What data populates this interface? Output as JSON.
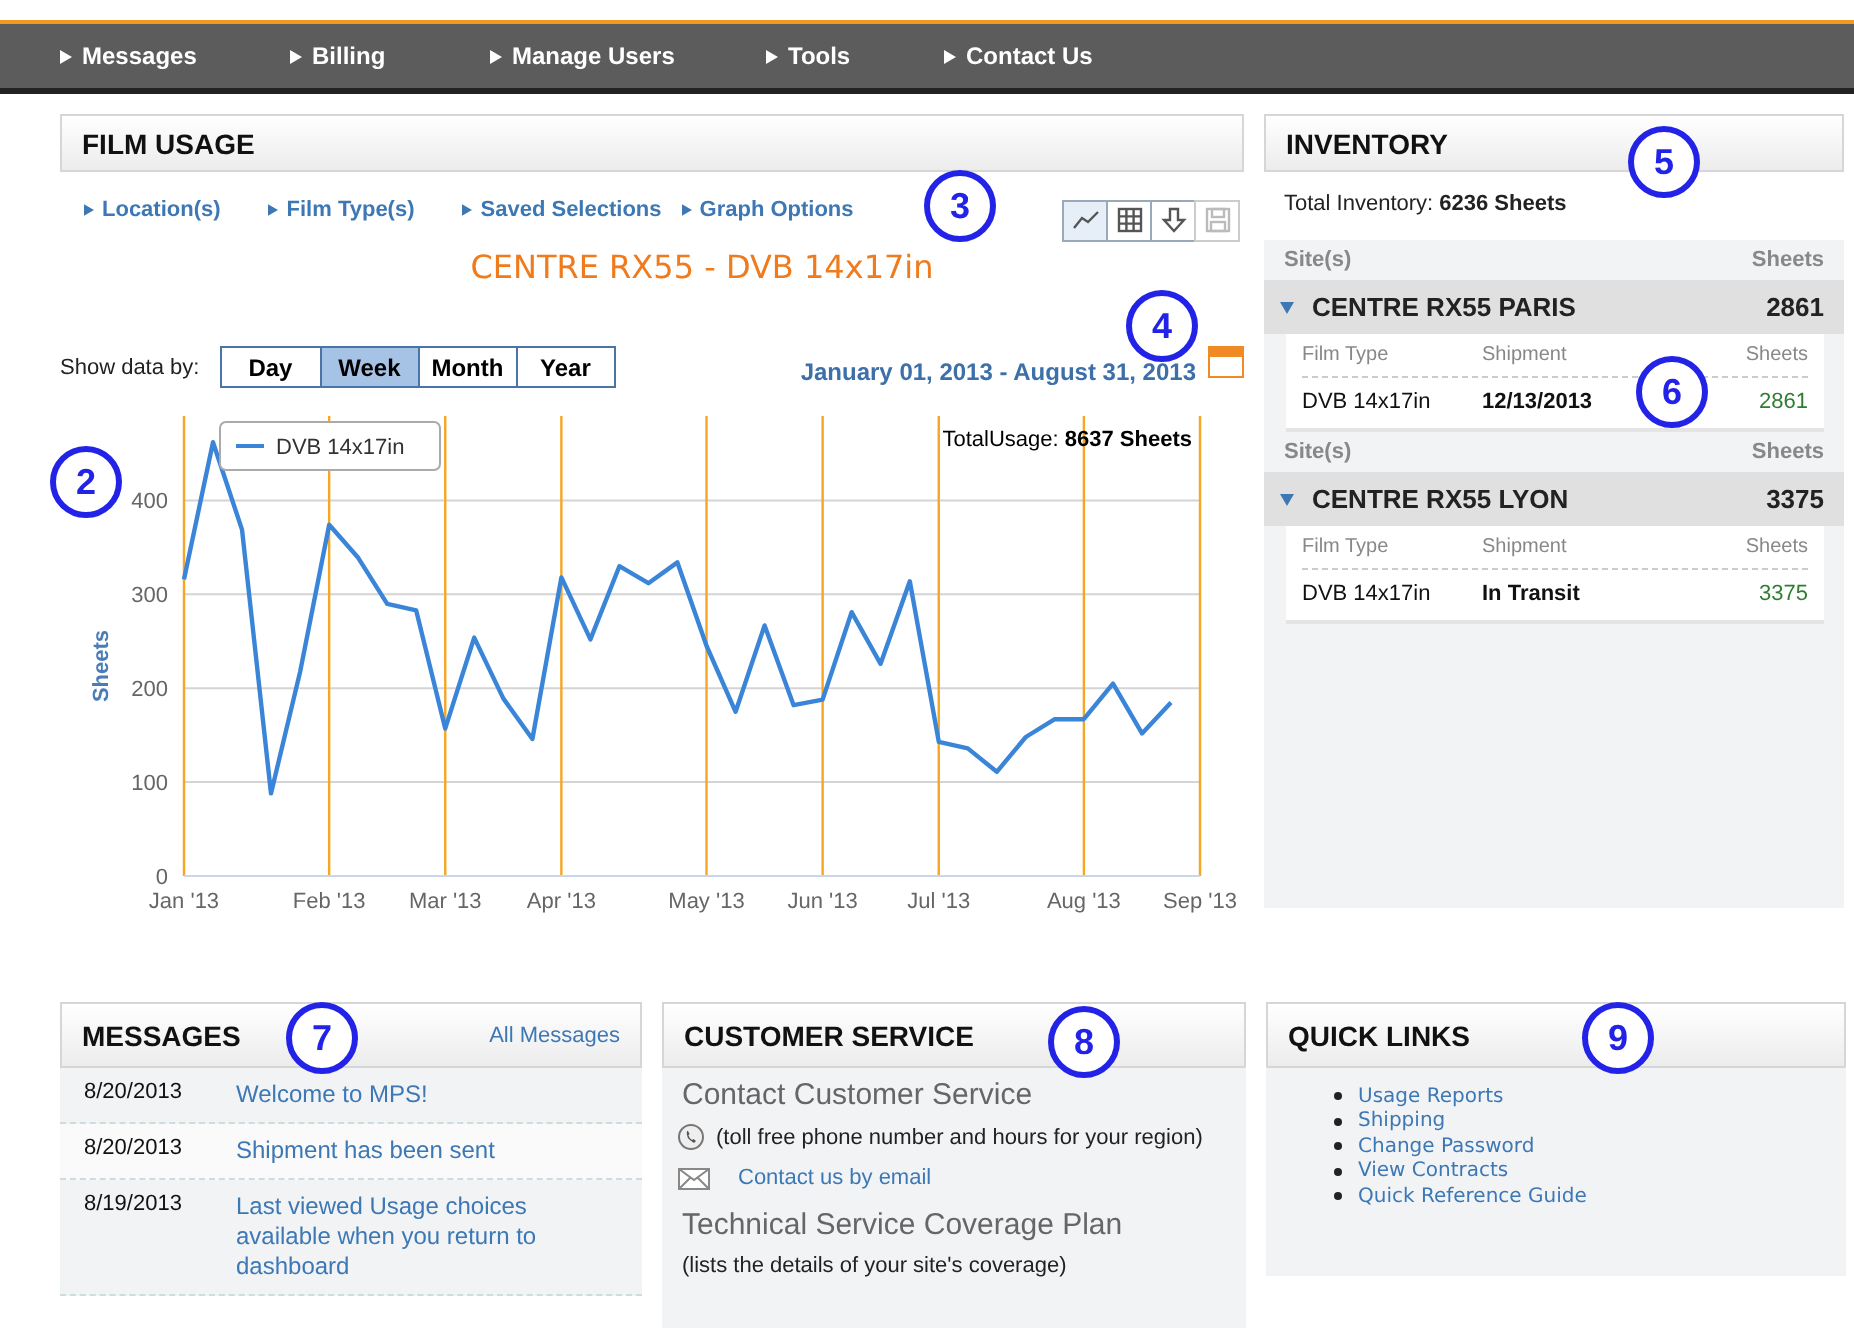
{
  "nav": {
    "items": [
      {
        "label": "Messages"
      },
      {
        "label": "Billing"
      },
      {
        "label": "Manage Users"
      },
      {
        "label": "Tools"
      },
      {
        "label": "Contact Us"
      }
    ]
  },
  "film_usage": {
    "title": "FILM USAGE",
    "links": [
      {
        "label": "Location(s)"
      },
      {
        "label": "Film Type(s)"
      },
      {
        "label": "Saved Selections"
      },
      {
        "label": "Graph Options"
      }
    ],
    "view_buttons": [
      {
        "kind": "line",
        "selected": true,
        "disabled": false
      },
      {
        "kind": "grid",
        "selected": false,
        "disabled": false
      },
      {
        "kind": "download",
        "selected": false,
        "disabled": false
      },
      {
        "kind": "save",
        "selected": false,
        "disabled": true
      }
    ],
    "chart_title": "CENTRE RX55 - DVB 14x17in",
    "show_data_label": "Show data by:",
    "periods": [
      {
        "label": "Day",
        "selected": false
      },
      {
        "label": "Week",
        "selected": true
      },
      {
        "label": "Month",
        "selected": false
      },
      {
        "label": "Year",
        "selected": false
      }
    ],
    "date_range": "January 01, 2013 - August 31, 2013",
    "total_usage": {
      "label": "TotalUsage:",
      "value": "8637 Sheets"
    },
    "chart_data": {
      "type": "line",
      "ylabel": "Sheets",
      "ylim": [
        0,
        490
      ],
      "grid": true,
      "categories": [
        "Jan '13",
        null,
        null,
        null,
        null,
        "Feb '13",
        null,
        null,
        null,
        "Mar '13",
        null,
        null,
        null,
        "Apr '13",
        null,
        null,
        null,
        null,
        "May '13",
        null,
        null,
        null,
        "Jun '13",
        null,
        null,
        null,
        "Jul '13",
        null,
        null,
        null,
        null,
        "Aug '13",
        null,
        null,
        null,
        "Sep '13"
      ],
      "yticks": [
        0,
        100,
        200,
        300,
        400
      ],
      "series": [
        {
          "name": "DVB 14x17in",
          "color": "#3a85d8",
          "values": [
            316,
            462,
            369,
            88,
            218,
            374,
            339,
            290,
            283,
            157,
            254,
            189,
            146,
            318,
            252,
            330,
            312,
            334,
            245,
            175,
            267,
            182,
            188,
            281,
            226,
            314,
            143,
            136,
            111,
            148,
            167,
            167,
            205,
            152,
            185,
            null
          ]
        }
      ]
    }
  },
  "inventory": {
    "title": "INVENTORY",
    "total_label": "Total Inventory:",
    "total_value": "6236 Sheets",
    "sites": [
      {
        "site_header": "Site(s)",
        "sheets_header": "Sheets",
        "name": "CENTRE RX55 PARIS",
        "sheets": "2861",
        "expanded": true,
        "columns": [
          "Film Type",
          "Shipment",
          "Sheets"
        ],
        "rows": [
          {
            "film_type": "DVB 14x17in",
            "shipment": "12/13/2013",
            "sheets": "2861"
          }
        ]
      },
      {
        "site_header": "Site(s)",
        "sheets_header": "Sheets",
        "name": "CENTRE RX55 LYON",
        "sheets": "3375",
        "expanded": true,
        "columns": [
          "Film Type",
          "Shipment",
          "Sheets"
        ],
        "rows": [
          {
            "film_type": "DVB 14x17in",
            "shipment": "In Transit",
            "sheets": "3375"
          }
        ]
      }
    ]
  },
  "messages": {
    "title": "MESSAGES",
    "all_link": "All Messages",
    "items": [
      {
        "date": "8/20/2013",
        "text": "Welcome to MPS!"
      },
      {
        "date": "8/20/2013",
        "text": "Shipment has been sent"
      },
      {
        "date": "8/19/2013",
        "text": "Last viewed Usage choices available when you return to dashboard"
      }
    ]
  },
  "customer_service": {
    "title": "CUSTOMER SERVICE",
    "contact_heading": "Contact Customer Service",
    "phone_text": "(toll free phone number and hours for your region)",
    "email_link": "Contact us by email",
    "plan_heading": "Technical Service Coverage Plan",
    "plan_text": "(lists the details of your site's coverage)"
  },
  "quick_links": {
    "title": "QUICK LINKS",
    "links": [
      "Usage Reports",
      "Shipping",
      "Change Password",
      "View Contracts",
      "Quick Reference Guide"
    ]
  },
  "callouts": [
    {
      "label": "2"
    },
    {
      "label": "3"
    },
    {
      "label": "4"
    },
    {
      "label": "5"
    },
    {
      "label": "6"
    },
    {
      "label": "7"
    },
    {
      "label": "8"
    },
    {
      "label": "9"
    }
  ]
}
